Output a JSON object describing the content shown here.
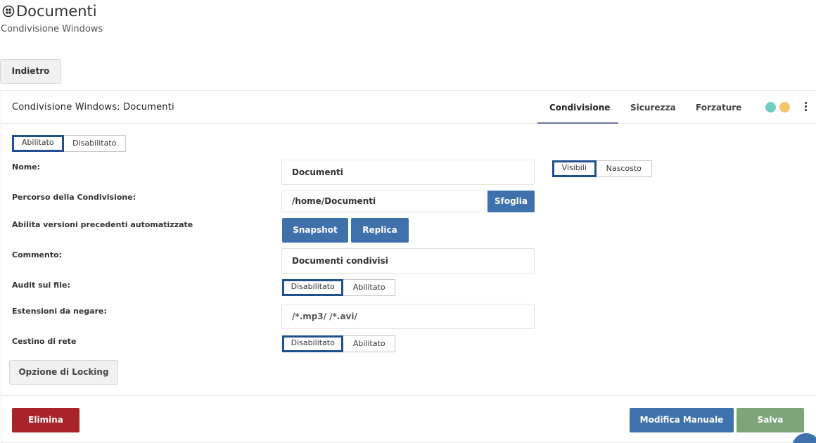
{
  "header": {
    "title": "Documenti",
    "subtitle": "Condivisione Windows"
  },
  "back_label": "Indietro",
  "panel": {
    "title": "Condivisione Windows: Documenti",
    "tabs": [
      "Condivisione",
      "Sicurezza",
      "Forzature"
    ],
    "active_tab": "Condivisione",
    "status_colors": [
      "#6fcfc4",
      "#f2c66a"
    ]
  },
  "enable_toggle": {
    "options": [
      "Abilitato",
      "Disabilitato"
    ],
    "selected": "Abilitato"
  },
  "visibility_toggle": {
    "options": [
      "Visibili",
      "Nascosto"
    ],
    "selected": "Visibili"
  },
  "form": {
    "name_label": "Nome:",
    "name_value": "Documenti",
    "path_label": "Percorso della Condivisione:",
    "path_value": "/home/Documenti",
    "browse_label": "Sfoglia",
    "versions_label": "Abilita versioni precedenti automatizzate",
    "snapshot_label": "Snapshot",
    "replica_label": "Replica",
    "comment_label": "Commento:",
    "comment_value": "Documenti condivisi",
    "audit_label": "Audit sui file:",
    "audit_toggle": {
      "options": [
        "Disabilitato",
        "Abilitato"
      ],
      "selected": "Disabilitato"
    },
    "ext_label": "Estensioni da negare:",
    "ext_value": "/*.mp3/ /*.avi/",
    "recycle_label": "Cestino di rete",
    "recycle_toggle": {
      "options": [
        "Disabilitato",
        "Abilitato"
      ],
      "selected": "Disabilitato"
    },
    "locking_label": "Opzione di Locking"
  },
  "footer": {
    "delete_label": "Elimina",
    "manual_label": "Modifica Manuale",
    "save_label": "Salva"
  },
  "colors": {
    "primary": "#3f72ad",
    "danger": "#a8232a",
    "success": "#7ea57a",
    "toggle_selected_border": "#1f4f8f"
  }
}
